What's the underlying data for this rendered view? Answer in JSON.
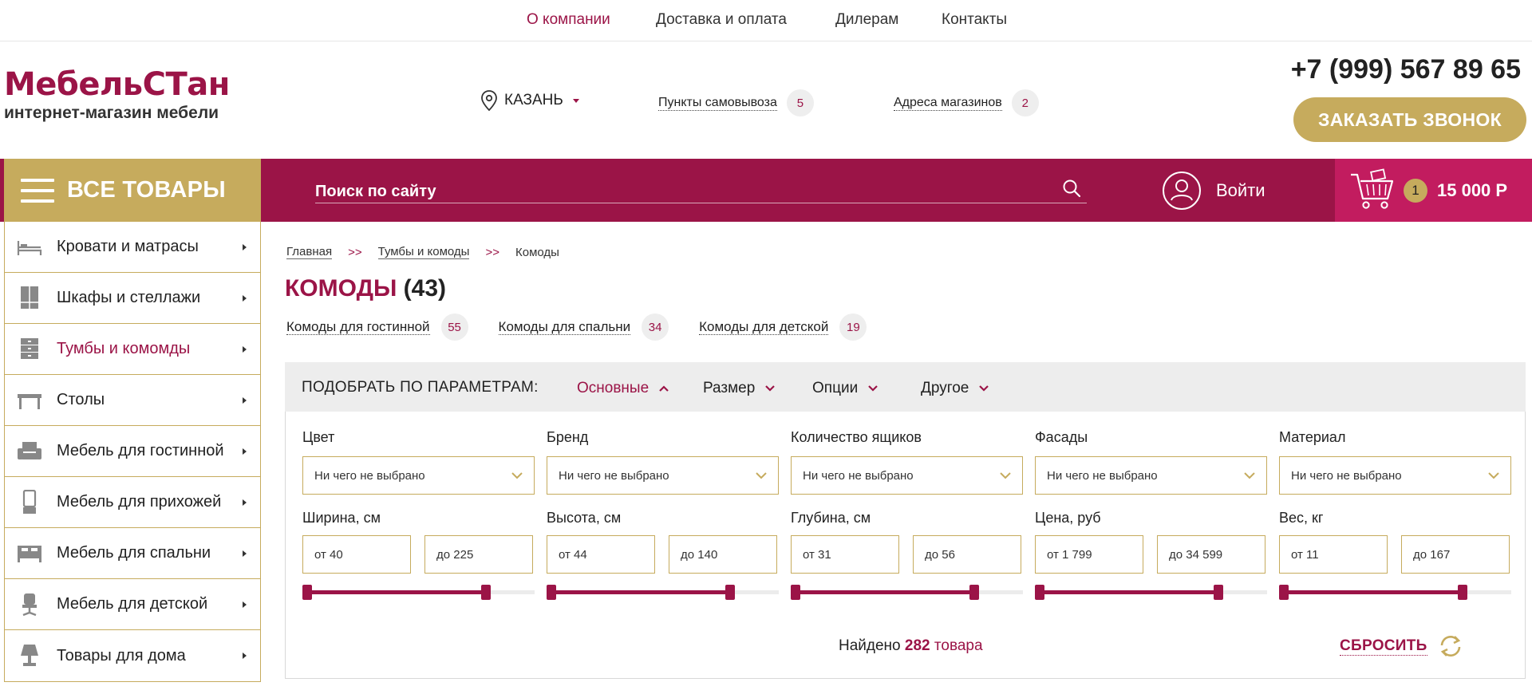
{
  "topnav": [
    {
      "label": "О компании",
      "active": true
    },
    {
      "label": "Доставка и оплата",
      "active": false
    },
    {
      "label": "Дилерам",
      "active": false
    },
    {
      "label": "Контакты",
      "active": false
    }
  ],
  "logo": {
    "name": "МебельСТан",
    "tagline": "интернет-магазин мебели"
  },
  "city": {
    "name": "КАЗАНЬ",
    "icon": "location-pin-icon"
  },
  "header_links": [
    {
      "label": "Пункты самовывоза",
      "count": "5"
    },
    {
      "label": "Адреса магазинов",
      "count": "2"
    }
  ],
  "phone": "+7 (999) 567 89 65",
  "callback_label": "ЗАКАЗАТЬ ЗВОНОК",
  "allgoods_label": "ВСЕ ТОВАРЫ",
  "search": {
    "placeholder": "Поиск по сайту"
  },
  "login_label": "Войти",
  "cart": {
    "count": "1",
    "sum": "15 000 Р"
  },
  "categories": [
    {
      "label": "Кровати и матрасы",
      "icon": "bed-icon",
      "active": false
    },
    {
      "label": "Шкафы и стеллажи",
      "icon": "wardrobe-icon",
      "active": false
    },
    {
      "label": "Тумбы и комомды",
      "icon": "dresser-icon",
      "active": true
    },
    {
      "label": "Столы",
      "icon": "table-icon",
      "active": false
    },
    {
      "label": "Мебель для гостинной",
      "icon": "armchair-icon",
      "active": false
    },
    {
      "label": "Мебель для прихожей",
      "icon": "hallway-mirror-icon",
      "active": false
    },
    {
      "label": "Мебель для спальни",
      "icon": "bedroom-bed-icon",
      "active": false
    },
    {
      "label": "Мебель для детской",
      "icon": "child-chair-icon",
      "active": false
    },
    {
      "label": "Товары для дома",
      "icon": "lamp-icon",
      "active": false
    }
  ],
  "breadcrumbs": {
    "home": "Главная",
    "parent": "Тумбы и комоды",
    "current": "Комоды",
    "sep": ">>"
  },
  "page_title": {
    "title": "КОМОДЫ",
    "count": "(43)"
  },
  "subcategories": [
    {
      "label": "Комоды для гостинной",
      "count": "55"
    },
    {
      "label": "Комоды для спальни",
      "count": "34"
    },
    {
      "label": "Комоды для детской",
      "count": "19"
    }
  ],
  "filter": {
    "title": "ПОДОБРАТЬ ПО ПАРАМЕТРАМ:",
    "tabs": [
      {
        "label": "Основные",
        "active": true
      },
      {
        "label": "Размер",
        "active": false
      },
      {
        "label": "Опции",
        "active": false
      },
      {
        "label": "Другое",
        "active": false
      }
    ],
    "selects": [
      {
        "label": "Цвет",
        "value": "Ни чего не выбрано"
      },
      {
        "label": "Бренд",
        "value": "Ни чего не выбрано"
      },
      {
        "label": "Количество ящиков",
        "value": "Ни чего не выбрано"
      },
      {
        "label": "Фасады",
        "value": "Ни чего не выбрано"
      },
      {
        "label": "Материал",
        "value": "Ни чего не выбрано"
      }
    ],
    "ranges": [
      {
        "label": "Ширина, см",
        "from": "от 40",
        "to": "до 225"
      },
      {
        "label": "Высота, см",
        "from": "от 44",
        "to": "до 140"
      },
      {
        "label": "Глубина, см",
        "from": "от 31",
        "to": "до 56"
      },
      {
        "label": "Цена, руб",
        "from": "от 1 799",
        "to": "до 34 599"
      },
      {
        "label": "Вес, кг",
        "from": "от 11",
        "to": "до 167"
      }
    ],
    "found": {
      "prefix": "Найдено",
      "number": "282",
      "word": "товара"
    },
    "reset_label": "СБРОСИТЬ"
  },
  "colors": {
    "brand": "#9b1447",
    "accent": "#c6ab5d",
    "cart_bg": "#c21c5f"
  }
}
